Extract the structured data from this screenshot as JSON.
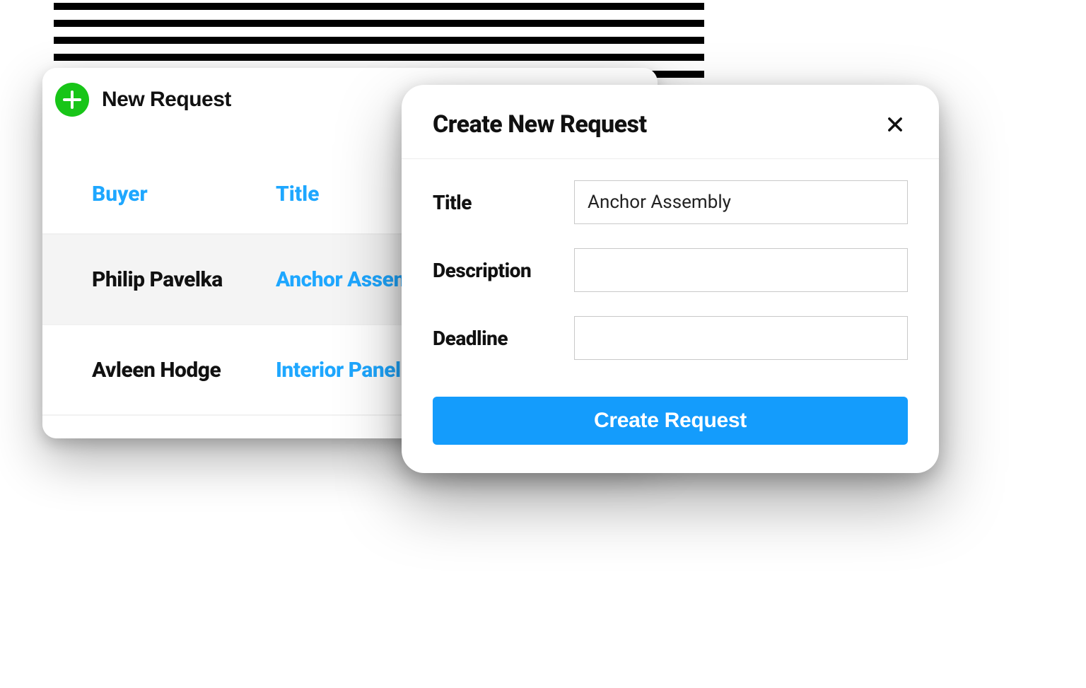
{
  "colors": {
    "accent": "#149cfc",
    "link": "#1ea7ff",
    "success": "#18c518"
  },
  "new_request_button": {
    "label": "New Request"
  },
  "table": {
    "columns": {
      "buyer": "Buyer",
      "title": "Title"
    },
    "rows": [
      {
        "buyer": "Philip Pavelka",
        "title": "Anchor Assembly"
      },
      {
        "buyer": "Avleen Hodge",
        "title": "Interior Panel"
      }
    ]
  },
  "modal": {
    "heading": "Create New Request",
    "fields": {
      "title": {
        "label": "Title",
        "value": "Anchor Assembly"
      },
      "description": {
        "label": "Description",
        "value": ""
      },
      "deadline": {
        "label": "Deadline",
        "value": ""
      }
    },
    "submit_label": "Create Request"
  }
}
